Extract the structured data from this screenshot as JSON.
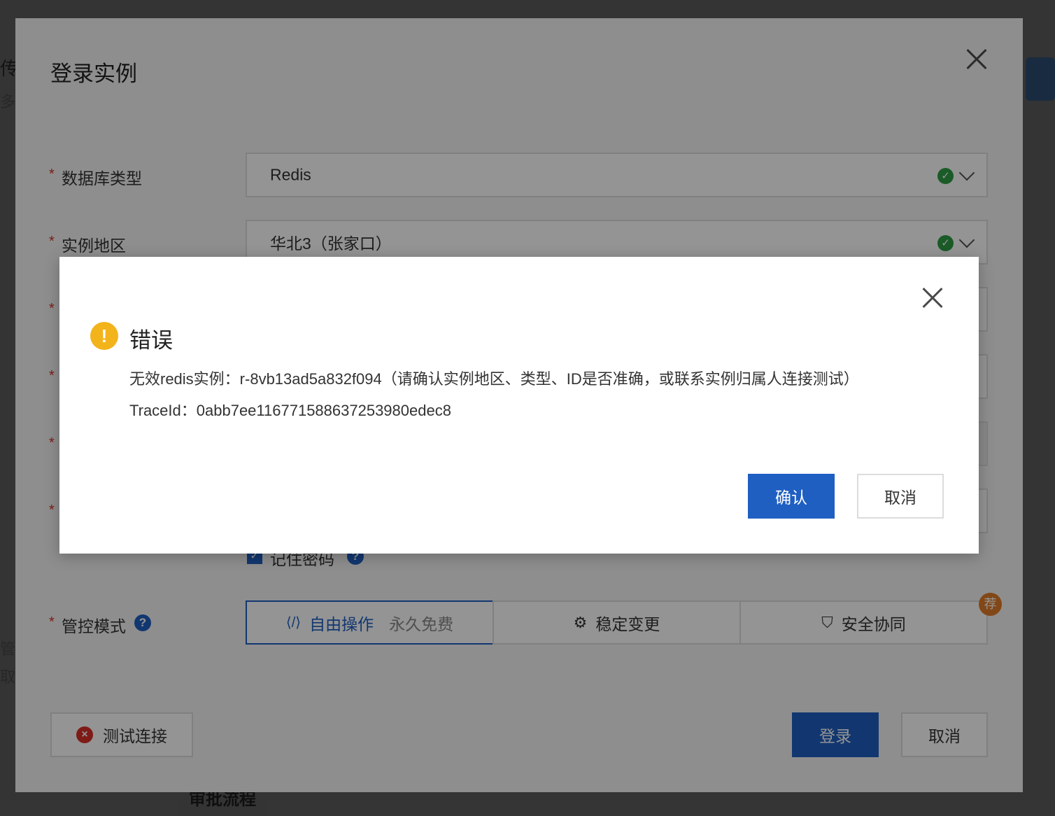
{
  "background": {
    "left_fragment_1": "传",
    "left_fragment_2": "多",
    "left_fragment_3": "管",
    "left_fragment_4": "取、",
    "bottom_text": "审批流程"
  },
  "login_dialog": {
    "title": "登录实例",
    "fields": {
      "db_type": {
        "label": "数据库类型",
        "value": "Redis"
      },
      "region": {
        "label": "实例地区",
        "value": "华北3（张家口）"
      }
    },
    "remember_password": "记住密码",
    "control_mode": {
      "label": "管控模式",
      "options": [
        {
          "label": "自由操作",
          "note": "永久免费"
        },
        {
          "label": "稳定变更"
        },
        {
          "label": "安全协同"
        }
      ],
      "recommend_badge": "荐"
    },
    "test_connection": "测试连接",
    "login_button": "登录",
    "cancel_button": "取消"
  },
  "error_dialog": {
    "title": "错误",
    "message": "无效redis实例：r-8vb13ad5a832f094（请确认实例地区、类型、ID是否准确，或联系实例归属人连接测试）",
    "trace_id": "TraceId：0abb7ee116771588637253980edec8",
    "confirm_button": "确认",
    "cancel_button": "取消"
  },
  "colors": {
    "primary": "#1f5fc2",
    "warning": "#f3b31b",
    "success": "#2e9e46",
    "error": "#d93026",
    "recommend": "#e07a26"
  }
}
